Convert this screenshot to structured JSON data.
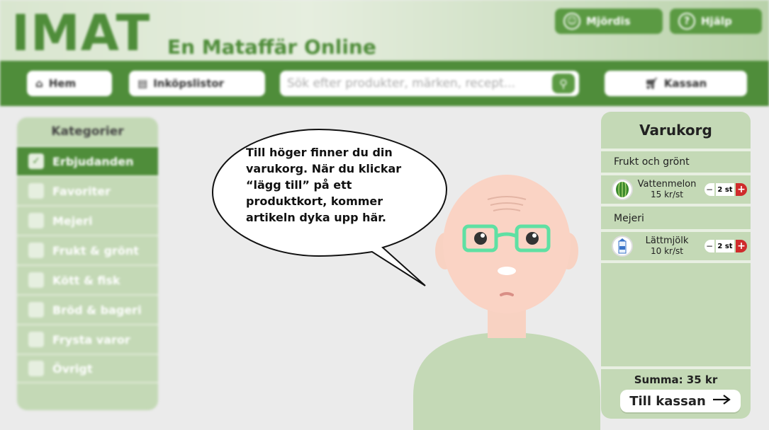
{
  "header": {
    "logo": "IMAT",
    "tagline": "En Mataffär Online",
    "account_label": "Mjördis",
    "help_label": "Hjälp"
  },
  "nav": {
    "home_label": "Hem",
    "lists_label": "Inköpslistor",
    "search_placeholder": "Sök efter produkter, märken, recept...",
    "checkout_label": "Kassan"
  },
  "sidebar": {
    "title": "Kategorier",
    "items": [
      {
        "label": "Erbjudanden",
        "checked": true
      },
      {
        "label": "Favoriter",
        "checked": false
      },
      {
        "label": "Mejeri",
        "checked": false
      },
      {
        "label": "Frukt & grönt",
        "checked": false
      },
      {
        "label": "Kött & fisk",
        "checked": false
      },
      {
        "label": "Bröd & bageri",
        "checked": false
      },
      {
        "label": "Frysta varor",
        "checked": false
      },
      {
        "label": "Övrigt",
        "checked": false
      }
    ]
  },
  "cart": {
    "title": "Varukorg",
    "groups": [
      {
        "name": "Frukt och grönt",
        "items": [
          {
            "name": "Vattenmelon",
            "price": "15 kr/st",
            "qty": "2 st"
          }
        ]
      },
      {
        "name": "Mejeri",
        "items": [
          {
            "name": "Lättmjölk",
            "price": "10 kr/st",
            "qty": "2 st"
          }
        ]
      }
    ],
    "total": "Summa: 35 kr",
    "checkout_button": "Till kassan"
  },
  "tutorial": {
    "speech": "Till höger finner du din varukorg. När du klickar “lägg till” på ett produktkort, kommer artikeln dyka upp här."
  },
  "colors": {
    "brand_green": "#4f8d3a",
    "panel_green": "#c4d9b6",
    "add_red": "#cf2b2b"
  }
}
